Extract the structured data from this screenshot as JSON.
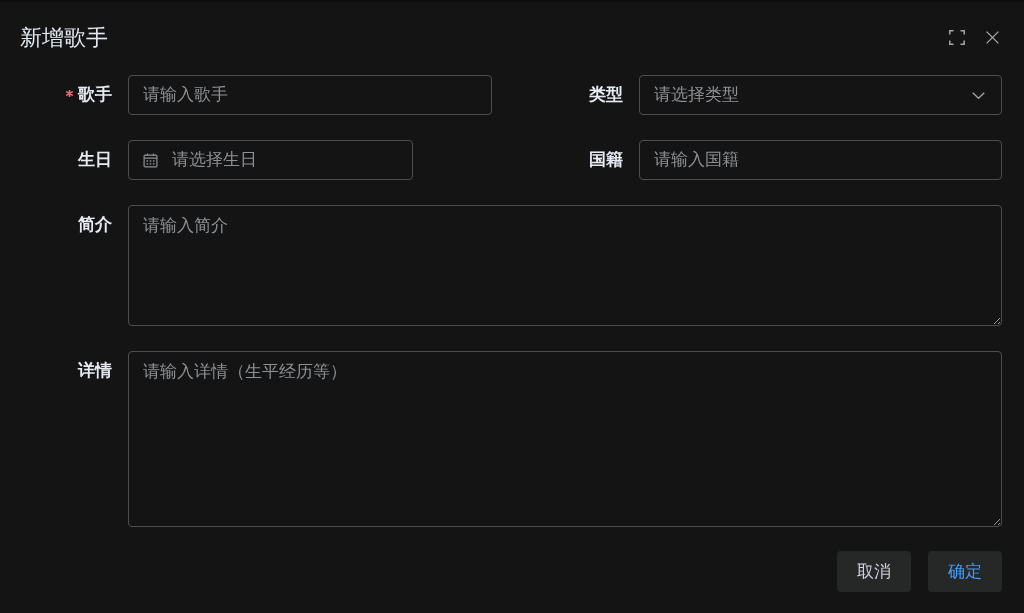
{
  "dialog": {
    "title": "新增歌手"
  },
  "form": {
    "fields": [
      {
        "label": "歌手",
        "required": true,
        "kind": "text",
        "placeholder": "请输入歌手"
      },
      {
        "label": "类型",
        "required": false,
        "kind": "select",
        "placeholder": "请选择类型"
      },
      {
        "label": "生日",
        "required": false,
        "kind": "date",
        "placeholder": "请选择生日"
      },
      {
        "label": "国籍",
        "required": false,
        "kind": "text",
        "placeholder": "请输入国籍"
      },
      {
        "label": "简介",
        "required": false,
        "kind": "textarea",
        "placeholder": "请输入简介"
      },
      {
        "label": "详情",
        "required": false,
        "kind": "textarea",
        "placeholder": "请输入详情（生平经历等）"
      }
    ]
  },
  "buttons": [
    {
      "label": "取消",
      "kind": "default"
    },
    {
      "label": "确定",
      "kind": "primary"
    }
  ]
}
